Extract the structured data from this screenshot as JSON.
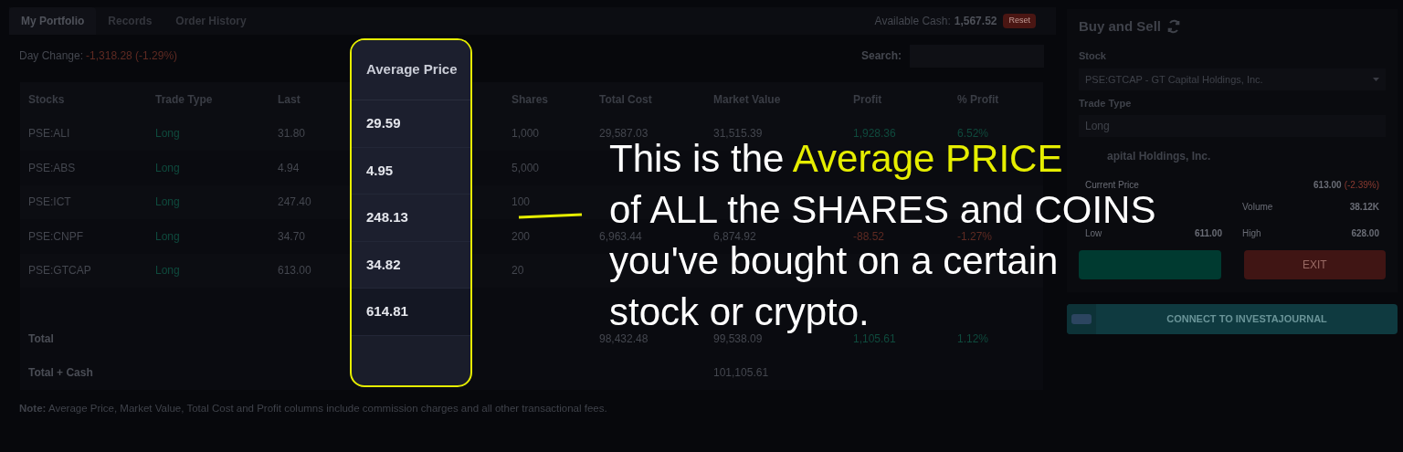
{
  "tabs": [
    {
      "label": "My Portfolio",
      "selected": true
    },
    {
      "label": "Records",
      "selected": false
    },
    {
      "label": "Order History",
      "selected": false
    }
  ],
  "available_cash": {
    "label": "Available Cash:",
    "value": "1,567.52"
  },
  "reset_button": "Reset",
  "day_change": {
    "label": "Day Change:",
    "value": "-1,318.28 (-1.29%)"
  },
  "search": {
    "label": "Search:"
  },
  "table": {
    "columns": [
      "Stocks",
      "Trade Type",
      "Last",
      "Shares",
      "Total Cost",
      "Market Value",
      "Profit",
      "% Profit"
    ],
    "rows": [
      {
        "cells": [
          {
            "text": "PSE:ALI"
          },
          {
            "text": "Long",
            "color": "#0f4a3d"
          },
          {
            "text": "31.80"
          },
          {
            "text": "1,000"
          },
          {
            "text": "29,587.03"
          },
          {
            "text": "31,515.39"
          },
          {
            "text": "1,928.36",
            "color": "#0f4a3d"
          },
          {
            "text": "6.52%",
            "color": "#0f4a3d"
          }
        ]
      },
      {
        "cells": [
          {
            "text": "PSE:ABS"
          },
          {
            "text": "Long",
            "color": "#0f4a3d"
          },
          {
            "text": "4.94"
          },
          {
            "text": "5,000"
          },
          null,
          null,
          null,
          null
        ]
      },
      {
        "cells": [
          {
            "text": "PSE:ICT"
          },
          {
            "text": "Long",
            "color": "#0f4a3d"
          },
          {
            "text": "247.40"
          },
          {
            "text": "100"
          },
          null,
          null,
          null,
          null
        ]
      },
      {
        "cells": [
          {
            "text": "PSE:CNPF"
          },
          {
            "text": "Long",
            "color": "#0f4a3d"
          },
          {
            "text": "34.70"
          },
          {
            "text": "200"
          },
          {
            "text": "6,963.44"
          },
          {
            "text": "6,874.92"
          },
          {
            "text": "-88.52",
            "color": "#5e2a22"
          },
          {
            "text": "-1.27%",
            "color": "#5e2a22"
          }
        ]
      },
      {
        "cells": [
          {
            "text": "PSE:GTCAP"
          },
          {
            "text": "Long",
            "color": "#0f4a3d"
          },
          {
            "text": "613.00"
          },
          {
            "text": "20"
          },
          null,
          null,
          null,
          null
        ]
      }
    ],
    "totals": [
      {
        "cells": [
          {
            "text": "Total",
            "bold": true
          },
          null,
          null,
          null,
          {
            "text": "98,432.48"
          },
          {
            "text": "99,538.09"
          },
          {
            "text": "1,105.61",
            "color": "#0f4a3d"
          },
          {
            "text": "1.12%",
            "color": "#0f4a3d"
          }
        ]
      },
      {
        "cells": [
          {
            "text": "Total + Cash",
            "bold": true
          },
          null,
          null,
          null,
          null,
          {
            "text": "101,105.61"
          },
          null,
          null
        ]
      }
    ]
  },
  "note": "**Note:** Average Price, Market Value, Total Cost and Profit columns include commission charges and all other transactional fees.",
  "buy_sell": {
    "title": "Buy and Sell",
    "stock_label": "Stock",
    "stock_value": "PSE:GTCAP - GT Capital Holdings, Inc.",
    "trade_type_label": "Trade Type",
    "trade_type_value": "Long",
    "company": "apital Holdings, Inc.",
    "current_price": {
      "label": "Current Price",
      "value": "613.00",
      "change": "(-2.39%)"
    },
    "stats": [
      {
        "label": "Volume",
        "value": "38.12K"
      },
      {
        "label": "Low",
        "value": "611.00"
      },
      {
        "label": "High",
        "value": "628.00"
      }
    ],
    "exit_button": "EXIT",
    "connect_button": "CONNECT TO INVESTAJOURNAL"
  },
  "highlight": {
    "header": "Average Price",
    "values": [
      "29.59",
      "4.95",
      "248.13",
      "34.82",
      "614.81"
    ]
  },
  "callout": {
    "lines": [
      [
        {
          "text": "This is the "
        },
        {
          "text": "Average PRICE",
          "accent": true
        }
      ],
      [
        {
          "text": "of ALL the SHARES and COINS"
        }
      ],
      [
        {
          "text": "you've bought on a certain"
        }
      ],
      [
        {
          "text": "stock or crypto."
        }
      ]
    ]
  }
}
